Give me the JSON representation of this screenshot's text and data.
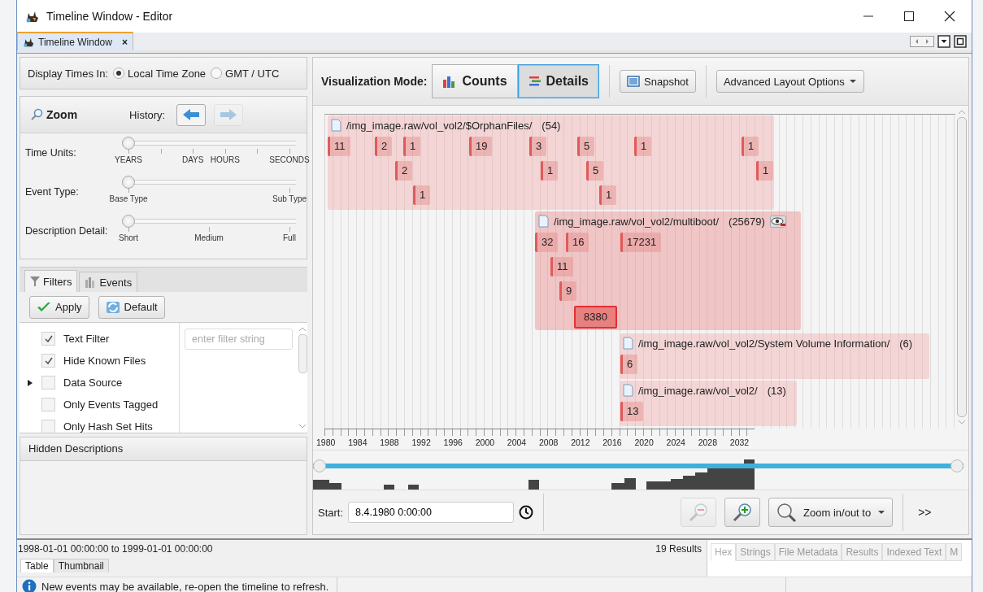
{
  "window": {
    "title": "Timeline Window - Editor"
  },
  "doc_tab": {
    "label": "Timeline Window",
    "close": "×",
    "selected": true
  },
  "display_times": {
    "label": "Display Times In:",
    "options": [
      {
        "label": "Local Time Zone",
        "selected": true
      },
      {
        "label": "GMT / UTC",
        "selected": false
      }
    ]
  },
  "zoom": {
    "title": "Zoom",
    "history_label": "History:",
    "history": [
      {
        "kind": "back",
        "disabled": false
      },
      {
        "kind": "forward",
        "disabled": true
      }
    ]
  },
  "sliders": [
    {
      "label": "Time Units:",
      "level": 0,
      "ticks": [
        "YEARS",
        "DAYS",
        "HOURS",
        "SECONDS"
      ]
    },
    {
      "label": "Event Type:",
      "level": 0,
      "ticks": [
        "Base Type",
        "Sub Type"
      ]
    },
    {
      "label": "Description Detail:",
      "level": 0,
      "ticks": [
        "Short",
        "Medium",
        "Full"
      ]
    }
  ],
  "filter_tabs": [
    {
      "label": "Filters",
      "kind": "filters",
      "selected": true
    },
    {
      "label": "Events",
      "kind": "events",
      "selected": false
    }
  ],
  "filter_buttons": [
    {
      "label": "Apply",
      "kind": "apply"
    },
    {
      "label": "Default",
      "kind": "default"
    }
  ],
  "filters": [
    {
      "label": "Text Filter",
      "checked": true,
      "kind": "text"
    },
    {
      "label": "Hide Known Files",
      "checked": true,
      "kind": "plain"
    },
    {
      "label": "Data Source",
      "checked": false,
      "kind": "group",
      "expanded": false
    },
    {
      "label": "Only Events Tagged",
      "checked": false,
      "kind": "plain"
    },
    {
      "label": "Only Hash Set Hits",
      "checked": false,
      "kind": "plain"
    }
  ],
  "filter_field": {
    "placeholder": "enter filter string"
  },
  "hidden_descriptions": {
    "title": "Hidden Descriptions"
  },
  "toolbar": {
    "mode_label": "Visualization Mode:",
    "modes": [
      {
        "label": "Counts",
        "kind": "counts",
        "selected": false
      },
      {
        "label": "Details",
        "kind": "details",
        "selected": true
      }
    ],
    "snapshot": "Snapshot",
    "advanced": "Advanced Layout Options"
  },
  "clusters": [
    {
      "path": "/img_image.raw/vol_vol2/$OrphanFiles/",
      "count": "(54)",
      "hide_button": false,
      "rows": [
        [
          {
            "label": "11",
            "selected": false
          },
          {
            "label": "2",
            "selected": false
          },
          {
            "label": "1",
            "selected": false
          },
          {
            "label": "19",
            "selected": false
          },
          {
            "label": "3",
            "selected": false
          },
          {
            "label": "5",
            "selected": false
          },
          {
            "label": "1",
            "selected": false
          },
          {
            "label": "1",
            "selected": false
          }
        ],
        [
          {
            "label": "2",
            "selected": false
          },
          {
            "label": "1",
            "selected": false
          },
          {
            "label": "5",
            "selected": false
          },
          {
            "label": "1",
            "selected": false
          }
        ],
        [
          {
            "label": "1",
            "selected": false
          },
          {
            "label": "1",
            "selected": false
          }
        ]
      ]
    },
    {
      "path": "/img_image.raw/vol_vol2/multiboot/",
      "count": "(25679)",
      "hide_button": true,
      "rows": [
        [
          {
            "label": "32",
            "selected": false
          },
          {
            "label": "16",
            "selected": false
          },
          {
            "label": "17231",
            "selected": false
          }
        ],
        [
          {
            "label": "11",
            "selected": false
          }
        ],
        [
          {
            "label": "9",
            "selected": false
          }
        ],
        [
          {
            "label": "8380",
            "selected": true
          }
        ]
      ]
    },
    {
      "path": "/img_image.raw/vol_vol2/System Volume Information/",
      "count": "(6)",
      "hide_button": false,
      "rows": [
        [
          {
            "label": "6",
            "selected": false
          }
        ]
      ]
    },
    {
      "path": "/img_image.raw/vol_vol2/",
      "count": "(13)",
      "hide_button": false,
      "rows": [
        [
          {
            "label": "13",
            "selected": false
          }
        ]
      ]
    }
  ],
  "axis_years": [
    "1980",
    "1984",
    "1988",
    "1992",
    "1996",
    "2000",
    "2004",
    "2008",
    "2012",
    "2016",
    "2020",
    "2024",
    "2028",
    "2032"
  ],
  "range_bar": {
    "thumbs": [
      {
        "level": 0
      },
      {
        "level": 1
      }
    ],
    "start_label": "Start:",
    "start_value": "8.4.1980 0:00:00",
    "zoom_out_disabled": true,
    "zoom_in_disabled": false,
    "zoom_menu": "Zoom in/out to",
    "overflow": ">>"
  },
  "results": {
    "range": "1998-01-01 00:00:00 to 1999-01-01 00:00:00",
    "count": "19  Results",
    "tabs": [
      {
        "label": "Table",
        "selected": true
      },
      {
        "label": "Thumbnail",
        "selected": false
      }
    ]
  },
  "viewer_tabs": [
    {
      "label": "Hex",
      "selected": true
    },
    {
      "label": "Strings",
      "selected": false
    },
    {
      "label": "File Metadata",
      "selected": false
    },
    {
      "label": "Results",
      "selected": false
    },
    {
      "label": "Indexed Text",
      "selected": false
    },
    {
      "label": "M",
      "selected": false
    }
  ],
  "status_bar": {
    "message": "New events may be available, re-open the timeline to refresh."
  }
}
